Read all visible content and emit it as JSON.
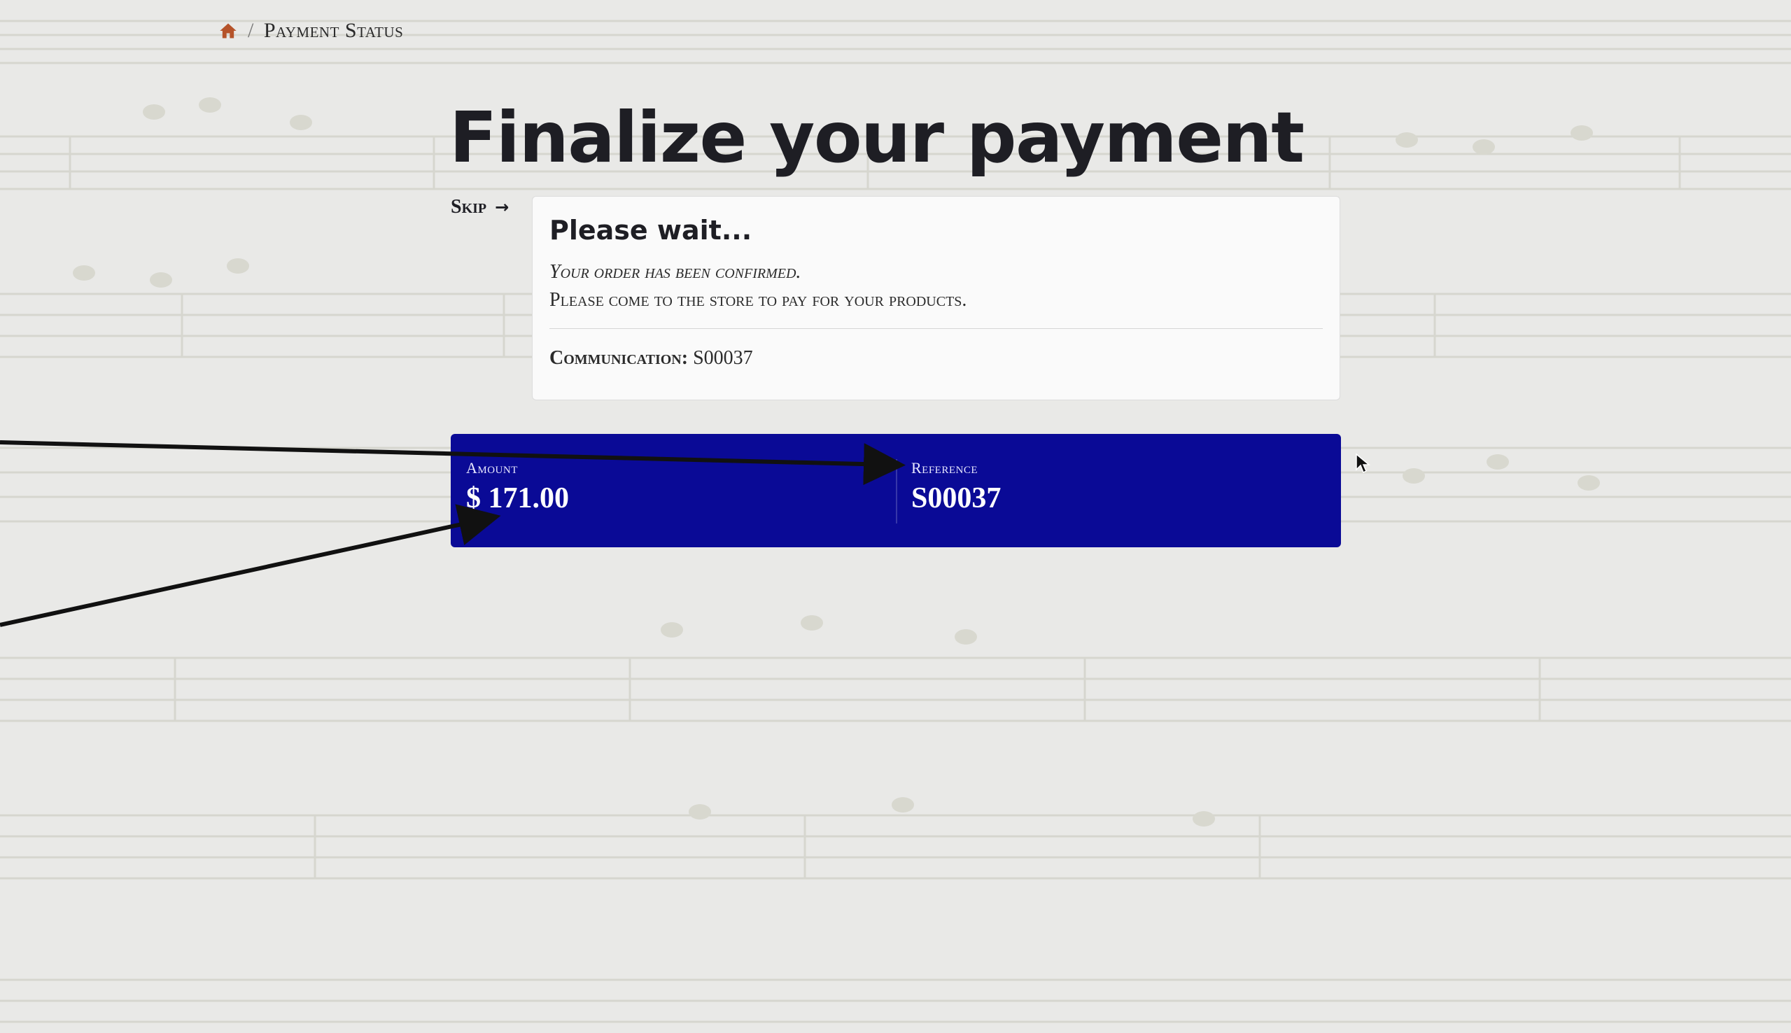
{
  "breadcrumb": {
    "home_icon": "home-icon",
    "separator": "/",
    "current": "Payment Status"
  },
  "page": {
    "title": "Finalize your payment"
  },
  "skip": {
    "label": "Skip",
    "arrow": "→"
  },
  "status_card": {
    "heading": "Please wait...",
    "line1": "Your order has been confirmed.",
    "line2": "Please come to the store to pay for your products.",
    "communication_label": "Communication:",
    "communication_value": "S00037"
  },
  "summary": {
    "amount_label": "Amount",
    "amount_value": "$ 171.00",
    "reference_label": "Reference",
    "reference_value": "S00037"
  },
  "colors": {
    "background": "#e9e9e7",
    "summary_bg": "#0a0a96",
    "home_icon": "#b5532a",
    "title": "#1e1e24"
  }
}
